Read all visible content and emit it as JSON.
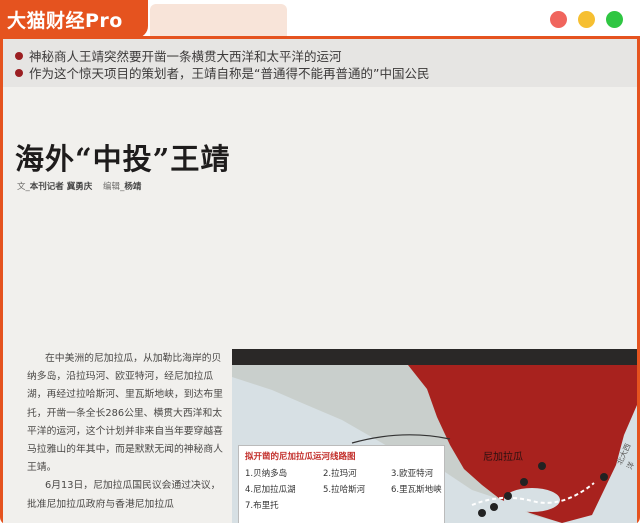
{
  "app": {
    "title": "大猫财经Pro",
    "accent": "#e5531f",
    "window_controls": [
      "close-icon",
      "minimize-icon",
      "maximize-icon"
    ]
  },
  "article": {
    "bullets": [
      "神秘商人王靖突然要开凿一条横贯大西洋和太平洋的运河",
      "作为这个惊天项目的策划者，王靖自称是“普通得不能再普通的”中国公民"
    ],
    "headline": "海外“中投”王靖",
    "byline": {
      "author_prefix": "文",
      "author": "本刊记者 冀勇庆",
      "editor_prefix": "编辑",
      "editor": "杨靖"
    },
    "body": [
      "在中美洲的尼加拉瓜，从加勒比海岸的贝纳多岛，沿拉玛河、欧亚特河，经尼加拉瓜湖，再经过拉哈斯河、里瓦斯地峡，到达布里托，开凿一条全长286公里、横贯大西洋和太平洋的运河，这个计划并非来自当年要穿越喜马拉雅山的年其中，而是默默无闻的神秘商人王靖。",
      "6月13日，尼加拉瓜国民议会通过决议，批准尼加拉瓜政府与香港尼加拉瓜"
    ]
  },
  "map": {
    "legend_title": "拟开凿的尼加拉瓜运河线路图",
    "legend_items": [
      "1.贝纳多岛",
      "2.拉玛河",
      "3.欧亚特河",
      "4.尼加拉瓜湖",
      "5.拉哈斯河",
      "6.里瓦斯地峡",
      "7.布里托"
    ],
    "country_label": "尼加拉瓜",
    "north_label": "北大西洋",
    "land_color": "#a8221e"
  }
}
